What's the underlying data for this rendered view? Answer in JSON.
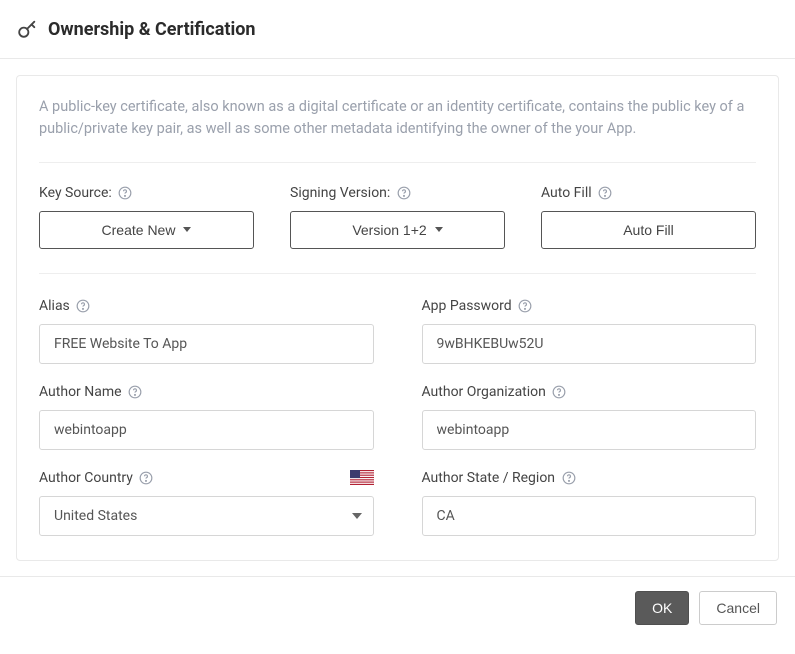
{
  "header": {
    "title": "Ownership & Certification"
  },
  "description": "A public-key certificate, also known as a digital certificate or an identity certificate, contains the public key of a public/private key pair, as well as some other metadata identifying the owner of the your App.",
  "topRow": {
    "keySource": {
      "label": "Key Source:",
      "value": "Create New"
    },
    "signingVersion": {
      "label": "Signing Version:",
      "value": "Version 1+2"
    },
    "autoFill": {
      "label": "Auto Fill",
      "button": "Auto Fill"
    }
  },
  "fields": {
    "alias": {
      "label": "Alias",
      "value": "FREE Website To App"
    },
    "appPassword": {
      "label": "App Password",
      "value": "9wBHKEBUw52U"
    },
    "authorName": {
      "label": "Author Name",
      "value": "webintoapp"
    },
    "authorOrg": {
      "label": "Author Organization",
      "value": "webintoapp"
    },
    "authorCountry": {
      "label": "Author Country",
      "value": "United States"
    },
    "authorState": {
      "label": "Author State / Region",
      "value": "CA"
    }
  },
  "footer": {
    "ok": "OK",
    "cancel": "Cancel"
  }
}
